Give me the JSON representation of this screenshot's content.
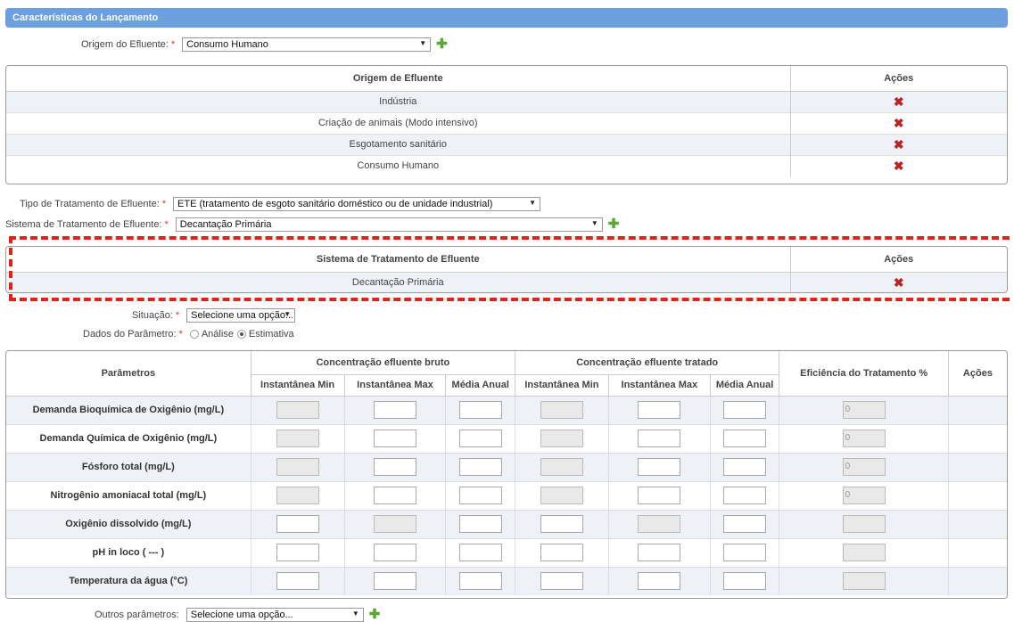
{
  "section_title": "Características do Lançamento",
  "origem": {
    "label": "Origem do Efluente:",
    "required": "*",
    "value": "Consumo Humano"
  },
  "origem_table": {
    "headers": [
      "Origem de Efluente",
      "Ações"
    ],
    "rows": [
      "Indústria",
      "Criação de animais (Modo intensivo)",
      "Esgotamento sanitário",
      "Consumo Humano"
    ]
  },
  "tipo": {
    "label": "Tipo de Tratamento de Efluente:",
    "required": "*",
    "value": "ETE (tratamento de esgoto sanitário doméstico ou de unidade industrial)"
  },
  "sistema": {
    "label": "Sistema de Tratamento de Efluente:",
    "required": "*",
    "value": "Decantação Primária"
  },
  "sistema_table": {
    "headers": [
      "Sistema de Tratamento de Efluente",
      "Ações"
    ],
    "rows": [
      "Decantação Primária"
    ]
  },
  "situacao": {
    "label": "Situação:",
    "required": "*",
    "value": "Selecione uma opção..."
  },
  "dados": {
    "label": "Dados do Parâmetro:",
    "required": "*",
    "options": [
      "Análise",
      "Estimativa"
    ],
    "selected": "Estimativa"
  },
  "params_table": {
    "col_param": "Parâmetros",
    "group_bruto": "Concentração efluente bruto",
    "group_tratado": "Concentração efluente tratado",
    "sub": [
      "Instantânea Min",
      "Instantânea Max",
      "Média Anual"
    ],
    "col_eff": "Eficiência do Tratamento %",
    "col_acoes": "Ações",
    "rows": [
      {
        "name": "Demanda Bioquímica de Oxigênio (mg/L)",
        "eff": "0"
      },
      {
        "name": "Demanda Química de Oxigênio (mg/L)",
        "eff": "0"
      },
      {
        "name": "Fósforo total (mg/L)",
        "eff": "0"
      },
      {
        "name": "Nitrogênio amoniacal total (mg/L)",
        "eff": "0"
      },
      {
        "name": "Oxigênio dissolvido (mg/L)",
        "eff": ""
      },
      {
        "name": "pH in loco ( --- )",
        "eff": ""
      },
      {
        "name": "Temperatura da água (°C)",
        "eff": ""
      }
    ]
  },
  "outros": {
    "label": "Outros parâmetros:",
    "value": "Selecione uma opção..."
  },
  "icons": {
    "plus": "add-icon",
    "delete": "delete-icon",
    "dropdown": "dropdown-arrow-icon"
  }
}
